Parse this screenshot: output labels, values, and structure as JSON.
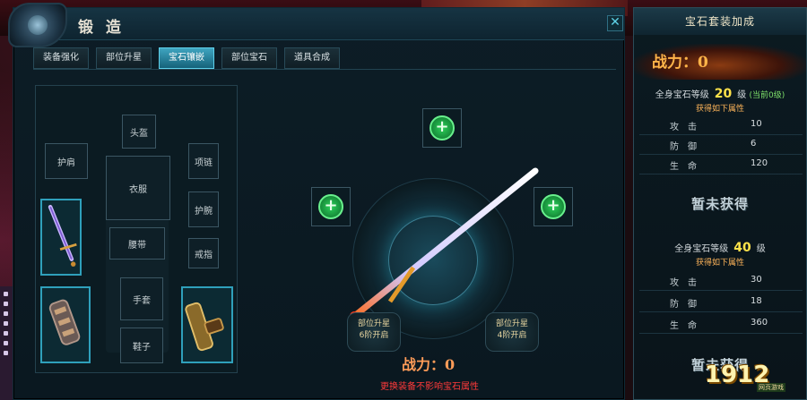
{
  "forge_window": {
    "title": "锻 造",
    "close_label": "✕",
    "tabs": [
      "装备强化",
      "部位升星",
      "宝石镶嵌",
      "部位宝石",
      "道具合成"
    ],
    "active_tab": 2
  },
  "equipment": {
    "slots": {
      "helmet": "头盔",
      "necklace": "护肩",
      "shoulder": "项链",
      "armor": "衣服",
      "belt": "腰带",
      "bracer": "护腕",
      "ring": "戒指",
      "gloves": "手套",
      "boots": "鞋子"
    }
  },
  "forge": {
    "lock_left": [
      "部位升星",
      "6阶开启"
    ],
    "lock_right": [
      "部位升星",
      "4阶开启"
    ],
    "power_label": "战力：0",
    "note": "更换装备不影响宝石属性"
  },
  "gemset": {
    "title": "宝石套装加成",
    "power": "战力：0",
    "tier1": {
      "level_label": "全身宝石等级",
      "level": "20",
      "level_unit": "级",
      "current": "(当前0级)",
      "cond": "获得如下属性",
      "stats": [
        {
          "k": "攻击",
          "v": "10"
        },
        {
          "k": "防御",
          "v": "6"
        },
        {
          "k": "生命",
          "v": "120"
        }
      ],
      "status": "暂未获得"
    },
    "tier2": {
      "level_label": "全身宝石等级",
      "level": "40",
      "level_unit": "级",
      "cond": "获得如下属性",
      "stats": [
        {
          "k": "攻击",
          "v": "30"
        },
        {
          "k": "防御",
          "v": "18"
        },
        {
          "k": "生命",
          "v": "360"
        }
      ],
      "status": "暂未获得"
    }
  },
  "watermark": {
    "text": "1912",
    "sub": "网页游戏"
  },
  "colors": {
    "accent": "#3fa4c0",
    "warn": "#ff3a3a",
    "gold": "#ffe24a",
    "gem_green": "#2bd15a"
  }
}
